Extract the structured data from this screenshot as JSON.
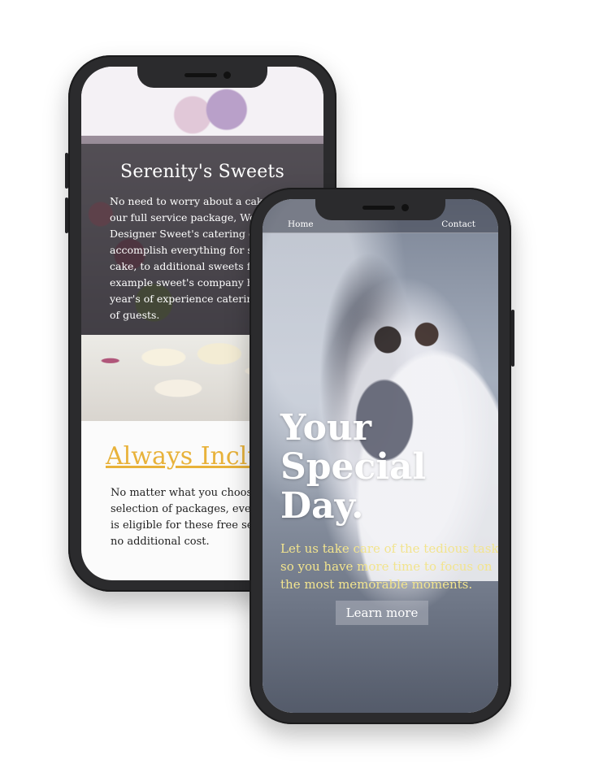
{
  "back_phone": {
    "title": "Serenity's Sweets",
    "body": "No need to worry about a cake! As\nour full service package, We wo\nDesigner Sweet's catering com\naccomplish everything for sty\ncake, to additional sweets for gu\nexample sweet's company has\nyear's of experience catering to\nof guests.",
    "heading": "Always Inclu",
    "heading_color": "#e8b23a",
    "paragraph": "No matter what you choose f\nselection of packages, every\nis eligible for these free ser\nno additional cost."
  },
  "front_phone": {
    "nav": {
      "home": "Home",
      "contact": "Contact"
    },
    "headline": "Your\nSpecial\nDay.",
    "tagline": "Let us take care of the tedious tasks,\nso you have more time to focus on\nthe most memorable moments.",
    "tagline_color": "#f2e48e",
    "cta_label": "Learn more"
  },
  "icons": [
    "speaker-icon",
    "camera-icon"
  ]
}
